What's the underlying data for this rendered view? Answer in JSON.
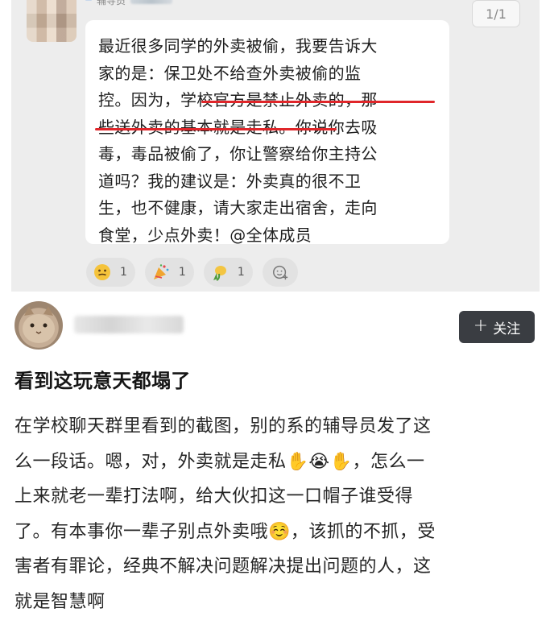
{
  "chat": {
    "role_tag": "",
    "role_name": "辅导员",
    "page_indicator": "1/1",
    "message_lines": [
      "最近很多同学的外卖被偷，我要告诉大",
      "家的是：保卫处不给查外卖被偷的监",
      "控。因为，学校官方是禁止外卖的，那",
      "些送外卖的基本就是走私。你说你去吸",
      "毒，毒品被偷了，你让警察给你主持公",
      "道吗？我的建议是：外卖真的很不卫",
      "生，也不健康，请大家走出宿舍，走向",
      "食堂，少点外卖！@全体成员"
    ],
    "reactions": [
      {
        "icon": "grimace-emoji-icon",
        "count": "1"
      },
      {
        "icon": "party-emoji-icon",
        "count": "1"
      },
      {
        "icon": "clap-emoji-icon",
        "count": "1"
      }
    ],
    "underline_color": "#e0262a"
  },
  "post": {
    "follow_label": "关注",
    "title": "看到这玩意天都塌了",
    "body_lines": [
      "在学校聊天群里看到的截图，别的系的辅导员发了这",
      "么一段话。嗯，对，外卖就是走私✋😭✋，怎么一",
      "上来就老一辈打法啊，给大伙扣这一口帽子谁受得",
      "了。有本事你一辈子别点外卖哦☺️，该抓的不抓，受",
      "害者有罪论，经典不解决问题解决提出问题的人，这",
      "就是智慧啊"
    ]
  },
  "colors": {
    "chat_background": "#ededed",
    "bubble_background": "#ffffff",
    "follow_button": "#3a3d42"
  }
}
